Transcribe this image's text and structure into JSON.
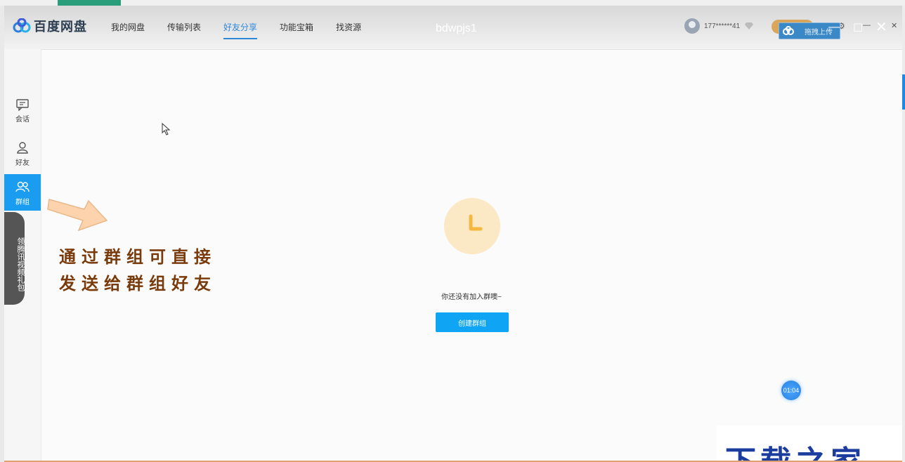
{
  "app": {
    "logo_text": "百度网盘",
    "window_title": "bdwpjs1"
  },
  "nav": {
    "items": [
      {
        "label": "我的网盘",
        "active": false
      },
      {
        "label": "传输列表",
        "active": false
      },
      {
        "label": "好友分享",
        "active": true
      },
      {
        "label": "功能宝箱",
        "active": false
      },
      {
        "label": "找资源",
        "active": false
      }
    ]
  },
  "user": {
    "name": "177******41"
  },
  "float_widget": {
    "label": "拖拽上传"
  },
  "sidebar": {
    "items": [
      {
        "label": "会话",
        "icon": "chat-icon",
        "active": false
      },
      {
        "label": "好友",
        "icon": "person-icon",
        "active": false
      },
      {
        "label": "群组",
        "icon": "group-icon",
        "active": true
      }
    ],
    "promo": "领腾讯视频礼包"
  },
  "annotation": {
    "line1": "通过群组可直接",
    "line2": "发送给群组好友"
  },
  "empty_state": {
    "message": "你还没有加入群噢~",
    "button": "创建群组"
  },
  "timer": "01:04",
  "watermark": "下载之家",
  "colors": {
    "accent": "#2e88d8",
    "active_sidebar": "#1a9cf0",
    "button": "#0fa5f4",
    "callout_text": "#7a3b0c"
  }
}
